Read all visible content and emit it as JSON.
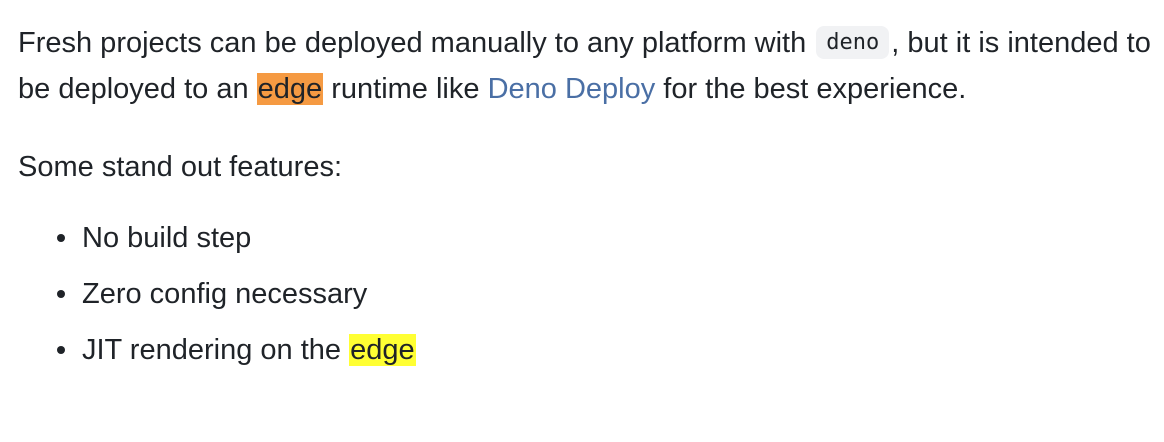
{
  "intro": {
    "text_before_code": "Fresh projects can be deployed manually to any platform with ",
    "code": "deno",
    "text_after_code": ", but it is intended to be deployed to an ",
    "highlight_word": "edge",
    "text_after_highlight": " runtime like ",
    "link_text": "Deno Deploy",
    "text_end": " for the best experience."
  },
  "features": {
    "heading": "Some stand out features:",
    "items": [
      {
        "text": "No build step",
        "highlight": ""
      },
      {
        "text": "Zero config necessary",
        "highlight": ""
      },
      {
        "text": "JIT rendering on the ",
        "highlight": "edge"
      }
    ]
  },
  "colors": {
    "current_match_highlight": "#f59a42",
    "search_match_highlight": "#ffff33",
    "link": "#4a6fa5",
    "code_background": "#f1f2f4"
  }
}
